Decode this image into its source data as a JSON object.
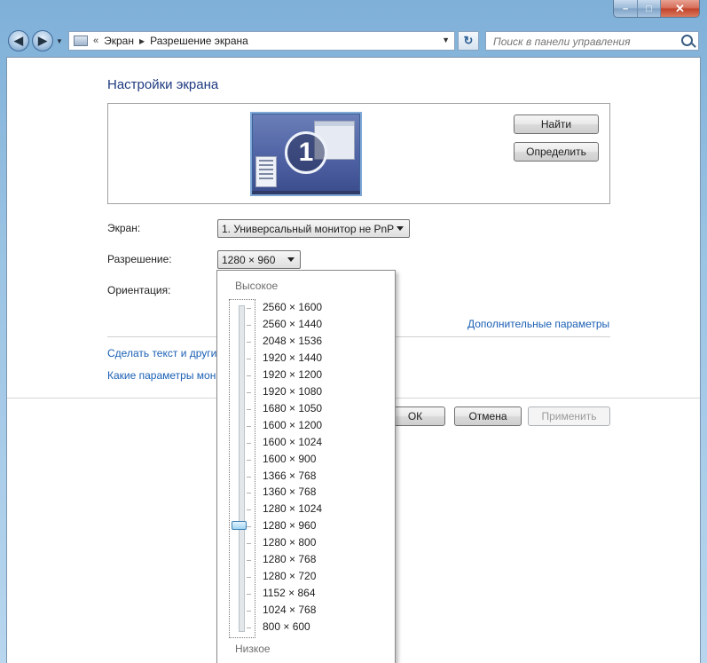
{
  "window": {
    "minimize_label": "–",
    "maximize_label": "□",
    "close_label": "✕"
  },
  "navbar": {
    "back_glyph": "◀",
    "forward_glyph": "▶",
    "history_glyph": "▼",
    "breadcrumb_overflow": "«",
    "crumb_1": "Экран",
    "crumb_sep": "▶",
    "crumb_2": "Разрешение экрана",
    "address_dropdown_glyph": "▼",
    "refresh_glyph": "↻",
    "search_placeholder": "Поиск в панели управления"
  },
  "page": {
    "heading": "Настройки экрана",
    "monitor_number": "1",
    "find_button": "Найти",
    "identify_button": "Определить",
    "screen_label": "Экран:",
    "screen_value": "1. Универсальный монитор не PnP",
    "resolution_label": "Разрешение:",
    "resolution_value": "1280 × 960",
    "orientation_label": "Ориентация:",
    "advanced_link": "Дополнительные параметры",
    "link_text_size": "Сделать текст и други",
    "link_which_params": "Какие параметры мон",
    "ok_button": "ОК",
    "cancel_button": "Отмена",
    "apply_button": "Применить"
  },
  "resolution_popup": {
    "high_label": "Высокое",
    "low_label": "Низкое",
    "options": [
      "2560 × 1600",
      "2560 × 1440",
      "2048 × 1536",
      "1920 × 1440",
      "1920 × 1200",
      "1920 × 1080",
      "1680 × 1050",
      "1600 × 1200",
      "1600 × 1024",
      "1600 × 900",
      "1366 × 768",
      "1360 × 768",
      "1280 × 1024",
      "1280 × 960",
      "1280 × 800",
      "1280 × 768",
      "1280 × 720",
      "1152 × 864",
      "1024 × 768",
      "800 × 600"
    ],
    "selected_index": 13
  },
  "colors": {
    "link": "#1a5fb4",
    "heading": "#1e3a80",
    "slider_thumb": "#9fd4f2"
  }
}
